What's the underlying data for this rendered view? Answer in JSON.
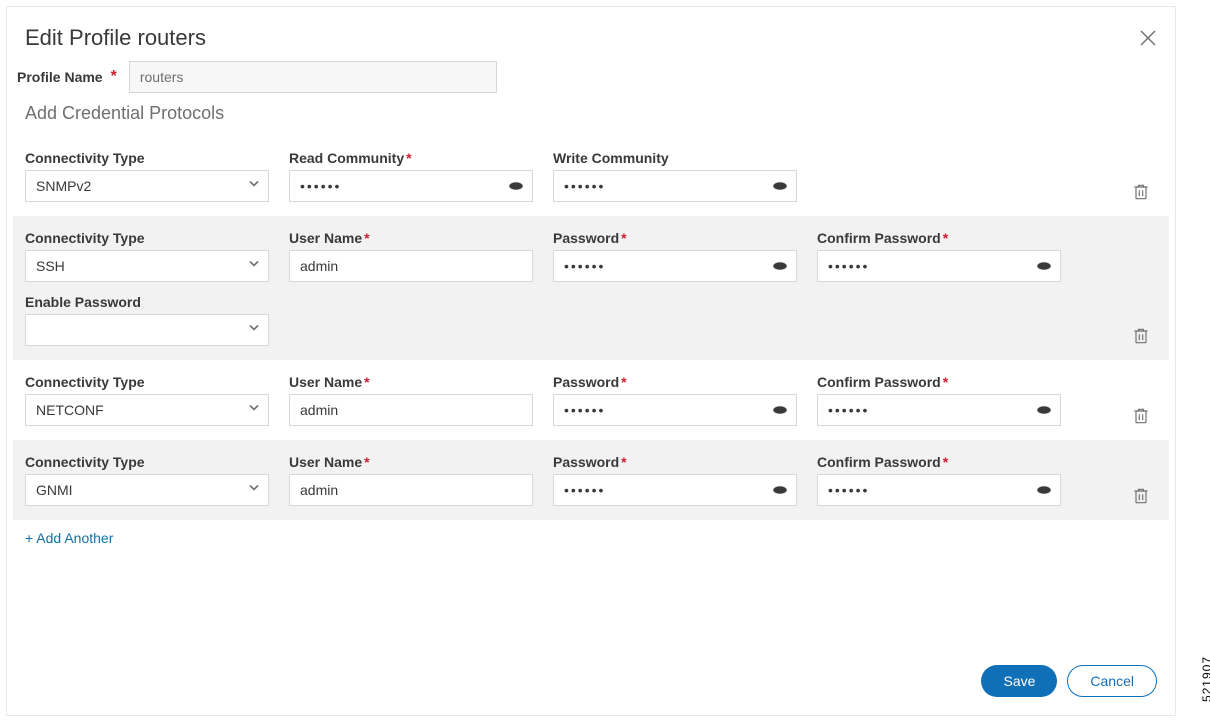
{
  "modal": {
    "title": "Edit Profile routers",
    "profileNameLabel": "Profile Name",
    "profileNameValue": "routers",
    "sectionTitle": "Add Credential Protocols"
  },
  "labels": {
    "connectivityType": "Connectivity Type",
    "readCommunity": "Read Community",
    "writeCommunity": "Write Community",
    "userName": "User Name",
    "password": "Password",
    "confirmPassword": "Confirm Password",
    "enablePassword": "Enable Password"
  },
  "rows": [
    {
      "type": "SNMPv2",
      "readCommunity": "••••••",
      "writeCommunity": "••••••"
    },
    {
      "type": "SSH",
      "userName": "admin",
      "password": "••••••",
      "confirmPassword": "••••••",
      "enablePassword": ""
    },
    {
      "type": "NETCONF",
      "userName": "admin",
      "password": "••••••",
      "confirmPassword": "••••••"
    },
    {
      "type": "GNMI",
      "userName": "admin",
      "password": "••••••",
      "confirmPassword": "••••••"
    }
  ],
  "addAnother": "+ Add Another",
  "footer": {
    "save": "Save",
    "cancel": "Cancel"
  },
  "sideId": "521907",
  "requiredMark": "*"
}
